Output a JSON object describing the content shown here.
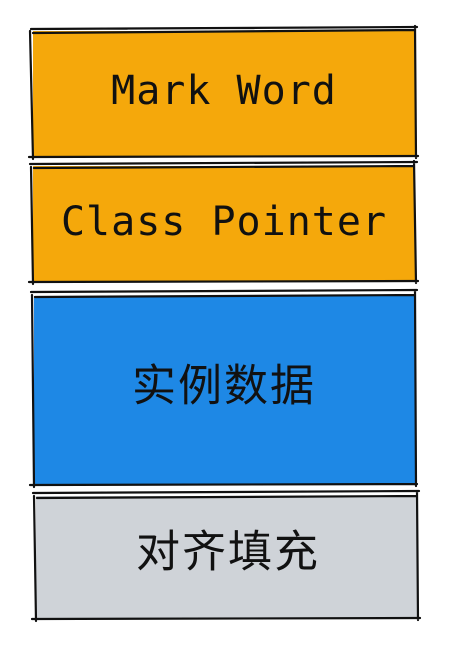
{
  "blocks": [
    {
      "id": "mark-word",
      "label": "Mark Word",
      "color": "#f5a80b",
      "style": "hand"
    },
    {
      "id": "class-pointer",
      "label": "Class Pointer",
      "color": "#f5a80b",
      "style": "hand"
    },
    {
      "id": "instance-data",
      "label": "实例数据",
      "color": "#1e88e5",
      "style": "cjk"
    },
    {
      "id": "padding",
      "label": "对齐填充",
      "color": "#cfd3d8",
      "style": "cjk"
    }
  ]
}
